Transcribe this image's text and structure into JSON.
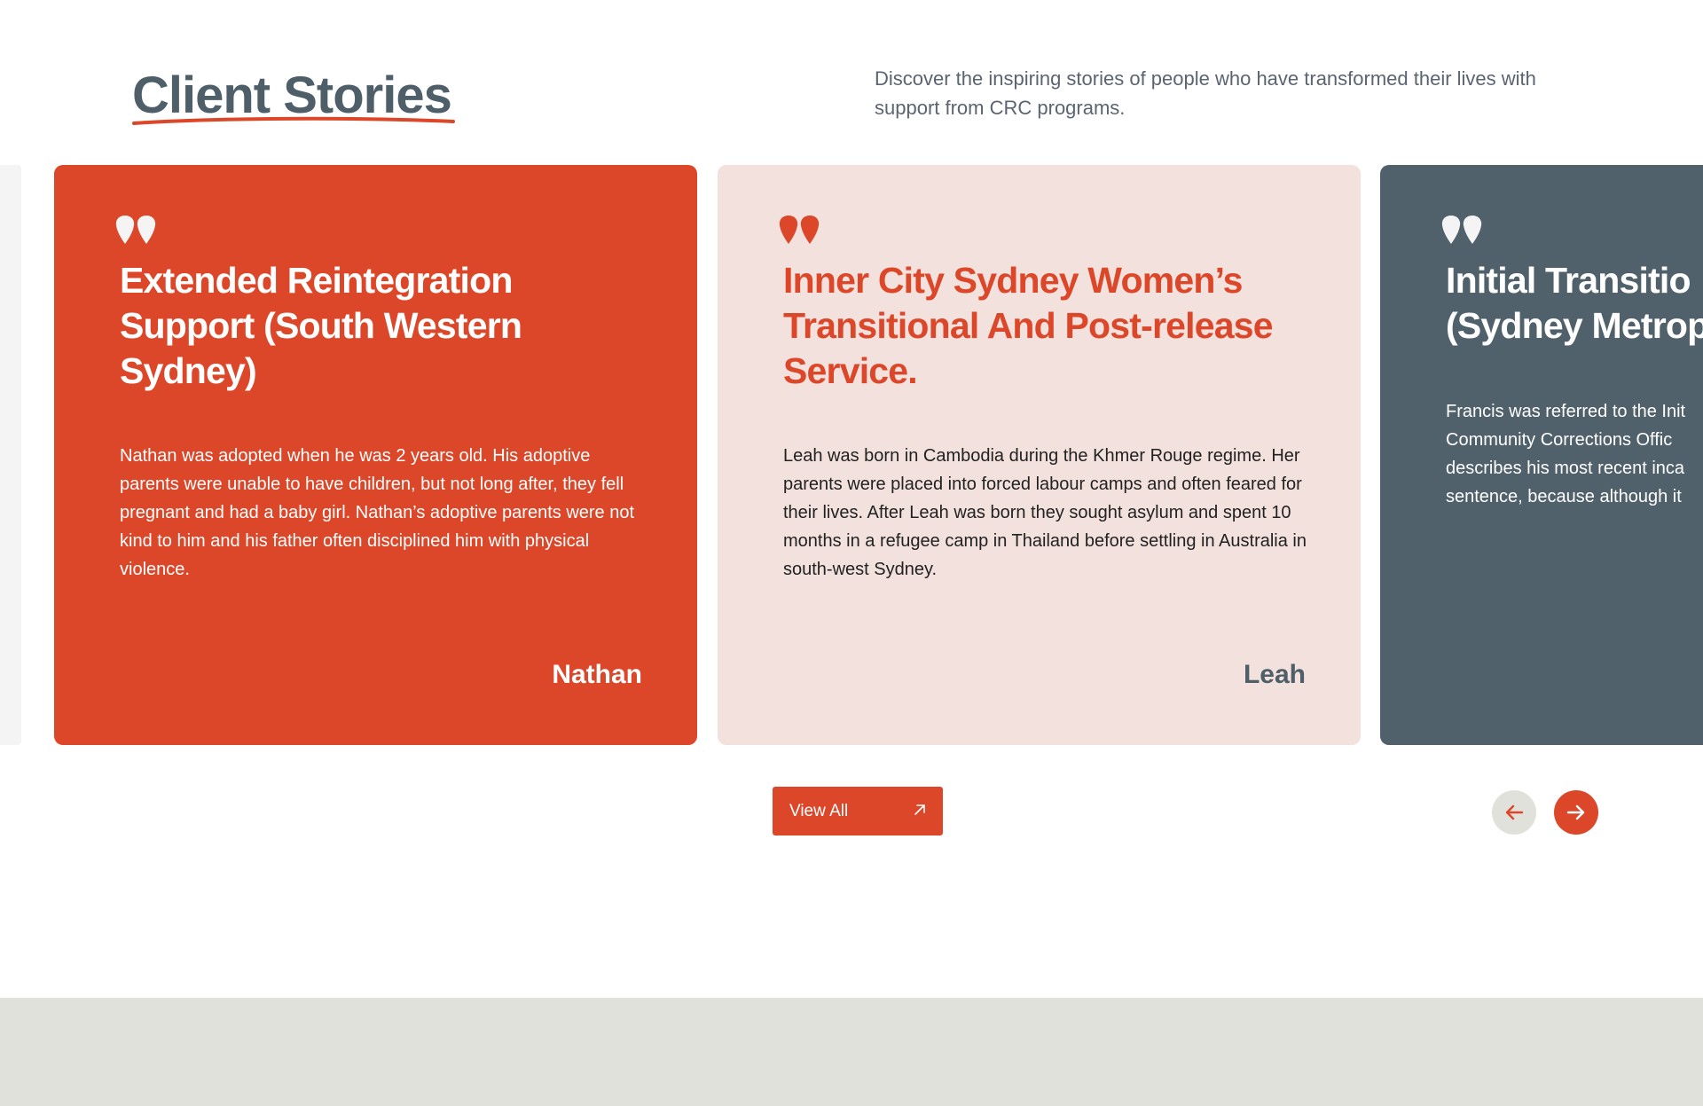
{
  "header": {
    "title": "Client Stories",
    "intro": "Discover the inspiring stories of people who have transformed their lives with support from CRC programs."
  },
  "stories": [
    {
      "title": "Extended Reintegration Support (South Western Sydney)",
      "body": "Nathan was adopted when he was 2 years old. His adoptive parents were unable to have children, but not long after, they fell pregnant and had a baby girl. Nathan’s adoptive parents were not kind to him and his father often disciplined him with physical violence.",
      "author": "Nathan"
    },
    {
      "title": "Inner City Sydney Women’s Transitional And Post-release Service.",
      "body": "Leah was born in Cambodia during the Khmer Rouge regime. Her parents were placed into forced labour camps and often feared for their lives. After Leah was born they sought asylum and spent 10 months in a refugee camp in Thailand before settling in Australia in south-west Sydney.",
      "author": "Leah"
    },
    {
      "title_lines": [
        "Initial Transitio",
        "(Sydney Metrop"
      ],
      "body_lines": [
        "Francis was referred to the Init",
        "Community Corrections Offic",
        "describes his most recent inca",
        "sentence, because although it"
      ]
    }
  ],
  "controls": {
    "view_all_label": "View All",
    "prev_icon": "arrow-left-icon",
    "next_icon": "arrow-right-icon"
  },
  "colors": {
    "accent": "#dc4629",
    "slate": "#51616b",
    "blush": "#f2e1dc"
  }
}
